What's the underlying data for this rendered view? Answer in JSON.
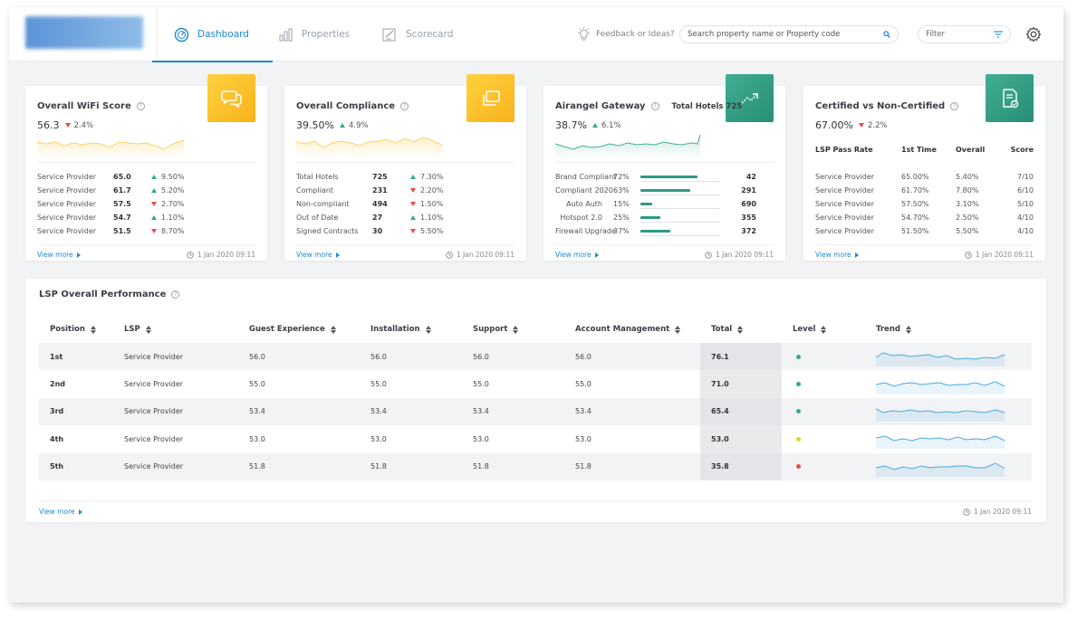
{
  "header": {
    "tabs": [
      {
        "label": "Dashboard",
        "active": true,
        "icon": "dashboard-icon"
      },
      {
        "label": "Properties",
        "active": false,
        "icon": "bar-chart-icon"
      },
      {
        "label": "Scorecard",
        "active": false,
        "icon": "scorecard-icon"
      }
    ],
    "feedback_label": "Feedback or Ideas?",
    "search_placeholder": "Search property name or Property code",
    "filter_label": "Filter"
  },
  "colors": {
    "accent": "#1e88d0",
    "positive": "#3aa887",
    "negative": "#e64a4a",
    "badge_yellow": "#f7b21b",
    "badge_green": "#2a8e77",
    "spark_yellow": "#f9d36b",
    "spark_green": "#3fae93",
    "trend_blue": "#4aa8e0"
  },
  "cards": {
    "wifi": {
      "title": "Overall WiFi Score",
      "value": "56.3",
      "delta": "2.4%",
      "delta_dir": "down",
      "rows": [
        {
          "label": "Service Provider",
          "value": "65.0",
          "delta": "9.50%",
          "dir": "up"
        },
        {
          "label": "Service Provider",
          "value": "61.7",
          "delta": "5.20%",
          "dir": "up"
        },
        {
          "label": "Service Provider",
          "value": "57.5",
          "delta": "2.70%",
          "dir": "down"
        },
        {
          "label": "Service Provider",
          "value": "54.7",
          "delta": "1.10%",
          "dir": "up"
        },
        {
          "label": "Service Provider",
          "value": "51.5",
          "delta": "8.70%",
          "dir": "down"
        }
      ],
      "view_more": "View more",
      "timestamp": "1 Jan 2020  09:11"
    },
    "compliance": {
      "title": "Overall Compliance",
      "value": "39.50%",
      "delta": "4.9%",
      "delta_dir": "up",
      "rows": [
        {
          "label": "Total Hotels",
          "value": "725",
          "delta": "7.30%",
          "dir": "up"
        },
        {
          "label": "Compliant",
          "value": "231",
          "delta": "2.20%",
          "dir": "down"
        },
        {
          "label": "Non-compliant",
          "value": "494",
          "delta": "1.50%",
          "dir": "down"
        },
        {
          "label": "Out of Date",
          "value": "27",
          "delta": "1.10%",
          "dir": "up"
        },
        {
          "label": "Signed Contracts",
          "value": "30",
          "delta": "5.50%",
          "dir": "down"
        }
      ],
      "view_more": "View more",
      "timestamp": "1 Jan 2020  09:11"
    },
    "gateway": {
      "title": "Airangel Gateway",
      "total_hotels": "Total Hotels 725",
      "value": "38.7%",
      "delta": "6.1%",
      "delta_dir": "up",
      "rows": [
        {
          "label": "Brand Compliant",
          "pct": "72%",
          "fill": 0.72,
          "value": "42"
        },
        {
          "label": "Compliant 2020",
          "pct": "63%",
          "fill": 0.63,
          "value": "291"
        },
        {
          "label": "Auto Auth",
          "pct": "15%",
          "fill": 0.15,
          "value": "690"
        },
        {
          "label": "Hotspot 2.0",
          "pct": "25%",
          "fill": 0.25,
          "value": "355"
        },
        {
          "label": "Firewall Upgrade",
          "pct": "37%",
          "fill": 0.37,
          "value": "372"
        }
      ],
      "view_more": "View more",
      "timestamp": "1 Jan 2020  09:11"
    },
    "certified": {
      "title": "Certified vs Non-Certified",
      "value": "67.00%",
      "delta": "2.2%",
      "delta_dir": "down",
      "columns": [
        "LSP Pass Rate",
        "1st Time",
        "Overall",
        "Score"
      ],
      "rows": [
        {
          "label": "Service Provider",
          "first": "65.00%",
          "overall": "5.40%",
          "score": "7/10"
        },
        {
          "label": "Service Provider",
          "first": "61.70%",
          "overall": "7.80%",
          "score": "6/10"
        },
        {
          "label": "Service Provider",
          "first": "57.50%",
          "overall": "3.10%",
          "score": "5/10"
        },
        {
          "label": "Service Provider",
          "first": "54.70%",
          "overall": "2.50%",
          "score": "4/10"
        },
        {
          "label": "Service Provider",
          "first": "51.50%",
          "overall": "5.50%",
          "score": "4/10"
        }
      ],
      "view_more": "View more",
      "timestamp": "1 Jan 2020  09:11"
    }
  },
  "lsp": {
    "title": "LSP Overall Performance",
    "columns": [
      "Position",
      "LSP",
      "Guest Experience",
      "Installation",
      "Support",
      "Account Management",
      "Total",
      "Level",
      "Trend"
    ],
    "rows": [
      {
        "position": "1st",
        "lsp": "Service Provider",
        "guest": "56.0",
        "install": "56.0",
        "support": "56.0",
        "account": "56.0",
        "total": "76.1",
        "level_color": "#3aa887"
      },
      {
        "position": "2nd",
        "lsp": "Service Provider",
        "guest": "55.0",
        "install": "55.0",
        "support": "55.0",
        "account": "55.0",
        "total": "71.0",
        "level_color": "#3aa887"
      },
      {
        "position": "3rd",
        "lsp": "Service Provider",
        "guest": "53.4",
        "install": "53.4",
        "support": "53.4",
        "account": "53.4",
        "total": "65.4",
        "level_color": "#3aa887"
      },
      {
        "position": "4th",
        "lsp": "Service Provider",
        "guest": "53.0",
        "install": "53.0",
        "support": "53.0",
        "account": "53.0",
        "total": "53.0",
        "level_color": "#e6d21e"
      },
      {
        "position": "5th",
        "lsp": "Service Provider",
        "guest": "51.8",
        "install": "51.8",
        "support": "51.8",
        "account": "51.8",
        "total": "35.8",
        "level_color": "#e64a4a"
      }
    ],
    "view_more": "View more",
    "timestamp": "1 Jan 2020  09:11"
  }
}
